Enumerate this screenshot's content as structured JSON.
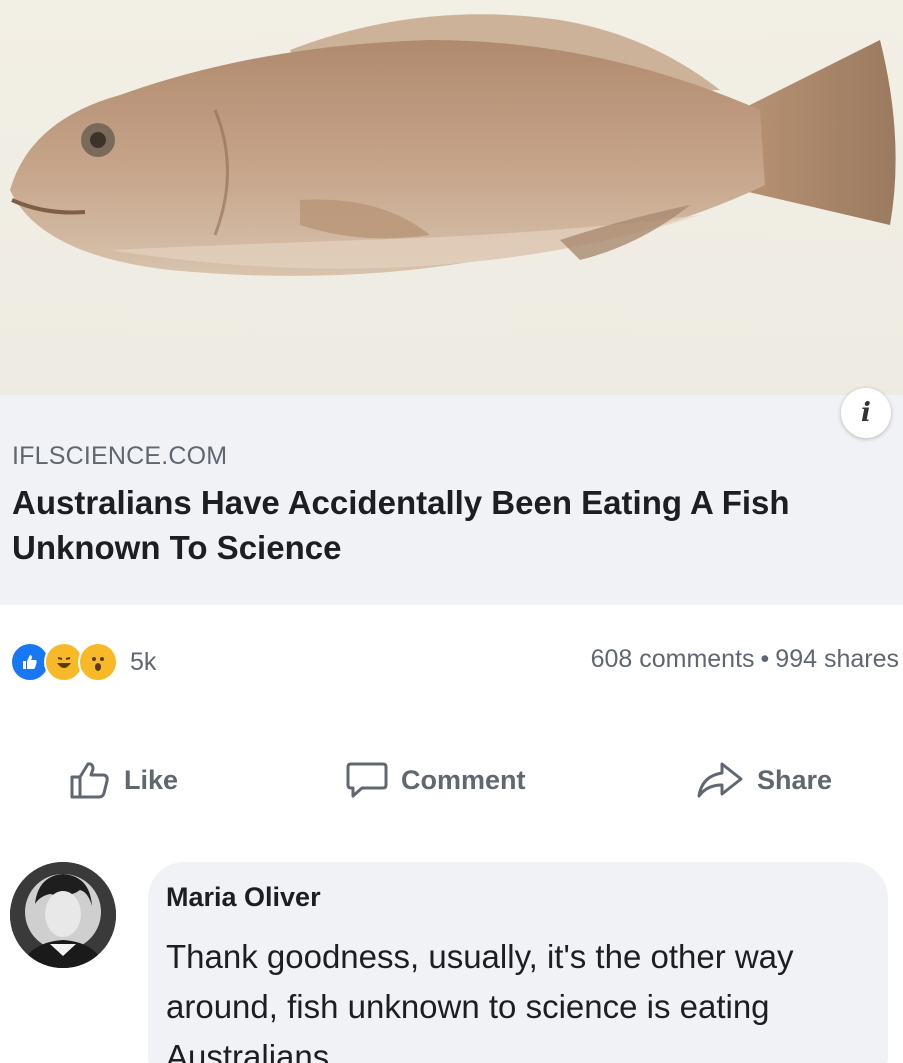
{
  "link": {
    "domain": "IFLSCIENCE.COM",
    "title": "Australians Have Accidentally Been Eating A Fish Unknown To Science",
    "info_icon": "info-icon"
  },
  "reactions": {
    "icons": [
      "like-reaction-icon",
      "haha-reaction-icon",
      "wow-reaction-icon"
    ],
    "count": "5k"
  },
  "stats": {
    "comments": "608 comments",
    "separator": "•",
    "shares": "994 shares"
  },
  "actions": {
    "like_label": "Like",
    "comment_label": "Comment",
    "share_label": "Share"
  },
  "comment": {
    "author": "Maria Oliver",
    "text": "Thank goodness, usually, it's the other way around, fish unknown to science is eating Australians"
  },
  "colors": {
    "accent": "#1877f2",
    "secondary_text": "#606770",
    "surface": "#f0f2f5"
  }
}
